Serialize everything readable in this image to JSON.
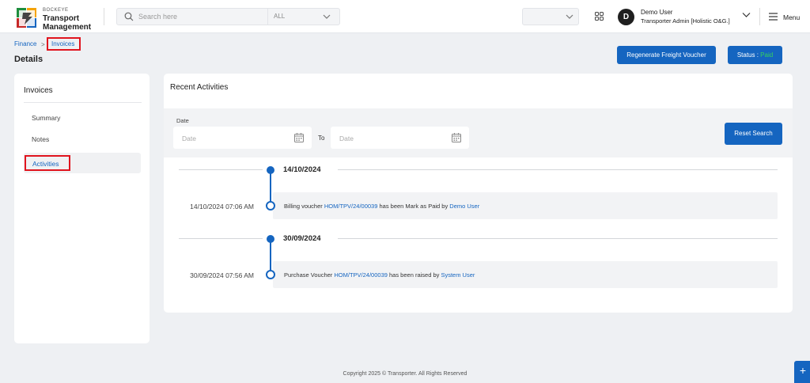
{
  "header": {
    "brand_small": "BOCKEYE",
    "brand_line1": "Transport",
    "brand_line2": "Management",
    "search_placeholder": "Search here",
    "search_scope": "ALL",
    "user_initial": "D",
    "user_name": "Demo User",
    "user_role": "Transporter Admin [Holistic O&G.]",
    "menu_label": "Menu"
  },
  "breadcrumb": {
    "parent": "Finance",
    "separator": ">",
    "current": "Invoices"
  },
  "page": {
    "title": "Details",
    "regenerate_label": "Regenerate Freight Voucher",
    "status_label": "Status :",
    "status_value": "Paid"
  },
  "sidebar": {
    "title": "Invoices",
    "items": [
      {
        "label": "Summary"
      },
      {
        "label": "Notes"
      },
      {
        "label": "Activities"
      }
    ]
  },
  "activities": {
    "title": "Recent Activities",
    "date_label": "Date",
    "from_placeholder": "Date",
    "to_label": "To",
    "to_placeholder": "Date",
    "reset_label": "Reset Search",
    "groups": [
      {
        "date": "14/10/2024",
        "time": "14/10/2024 07:06 AM",
        "pre": "Billing voucher ",
        "ref": "HOM/TPV/24/00039",
        "mid": " has been Mark as Paid by ",
        "user": "Demo User"
      },
      {
        "date": "30/09/2024",
        "time": "30/09/2024 07:56 AM",
        "pre": "Purchase Voucher ",
        "ref": "HOM/TPV/24/00039",
        "mid": " has been raised by ",
        "user": "System User"
      }
    ]
  },
  "footer": {
    "text": "Copyright 2025 © Transporter. All Rights Reserved"
  },
  "fab": {
    "label": "+"
  },
  "colors": {
    "accent": "#1565c0",
    "highlight": "#e0141e",
    "paid": "#37d35b"
  }
}
